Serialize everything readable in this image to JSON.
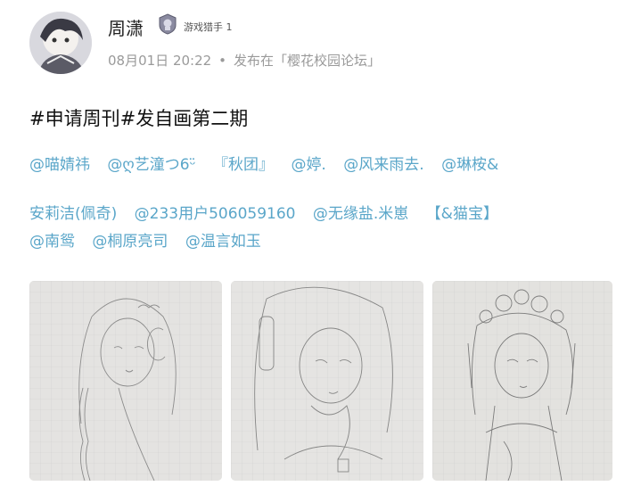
{
  "post": {
    "author": {
      "name": "周潇",
      "badge_label": "游戏猎手 1"
    },
    "date": "08月01日 20:22",
    "separator": "•",
    "published_in": "发布在「樱花校园论坛」",
    "title": "#申请周刊#发自画第二期",
    "mentions_line1": [
      "@喵婧祎",
      "@ღ艺潼つ6ᵕ̈",
      "『秋团』",
      "@婷.",
      "@风来雨去.",
      "@琳桉&"
    ],
    "mentions_line2": [
      "安莉洁(佩奇)",
      "@233用户506059160",
      "@无缘盐.米崽",
      "【&猫宝】"
    ],
    "mentions_line3": [
      "@南鸳",
      "@桐原亮司",
      "@温言如玉"
    ]
  },
  "images": [
    {
      "subject": "pencil sketch of girl with braided hair and headphones"
    },
    {
      "subject": "pencil sketch of girl with long hair holding hand to face"
    },
    {
      "subject": "pencil sketch of girl with flower hair ornaments"
    }
  ]
}
